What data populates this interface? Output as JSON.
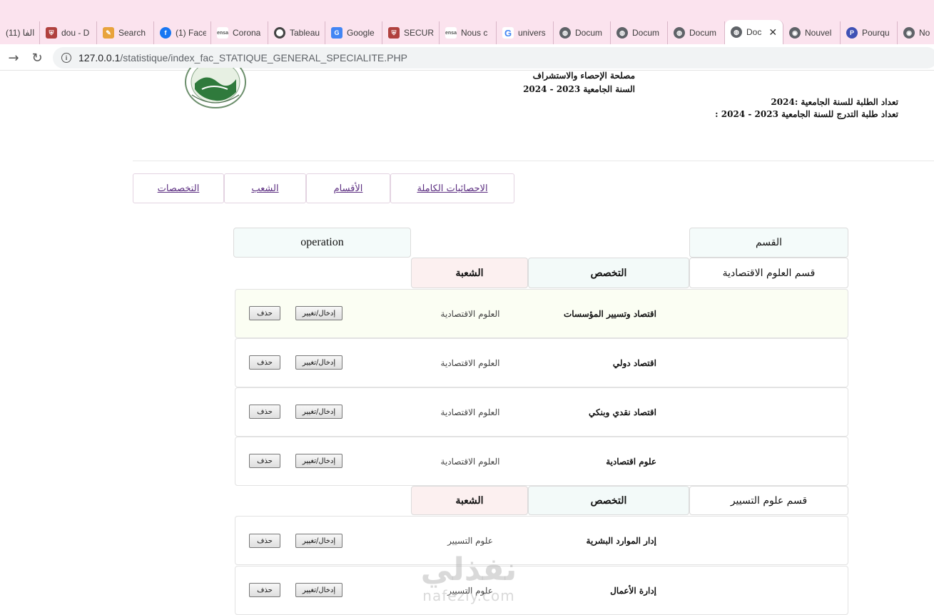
{
  "browser": {
    "tabs": [
      {
        "label": "(11) الفا",
        "icon": "generic-page-icon",
        "color": "#888888"
      },
      {
        "label": "dou - D",
        "icon": "shield-icon",
        "color": "#b0413e"
      },
      {
        "label": "Search",
        "icon": "search-app-icon",
        "color": "#e8a33c"
      },
      {
        "label": "(1) Face",
        "icon": "facebook-icon",
        "color": "#1877f2"
      },
      {
        "label": "Corona",
        "icon": "ensa-icon",
        "color": "#555555"
      },
      {
        "label": "Tableau",
        "icon": "circle-icon",
        "color": "#444444"
      },
      {
        "label": "Google",
        "icon": "google-translate-icon",
        "color": "#4285f4"
      },
      {
        "label": "SECURI",
        "icon": "shield-icon",
        "color": "#b0413e"
      },
      {
        "label": "Nous c",
        "icon": "ensa-icon",
        "color": "#555555"
      },
      {
        "label": "univers",
        "icon": "google-icon",
        "color": "#4285f4"
      },
      {
        "label": "Docum",
        "icon": "globe-icon",
        "color": "#5f6368"
      },
      {
        "label": "Docum",
        "icon": "globe-icon",
        "color": "#5f6368"
      },
      {
        "label": "Docum",
        "icon": "globe-icon",
        "color": "#5f6368"
      },
      {
        "label": "Doc",
        "icon": "globe-icon",
        "color": "#5f6368",
        "active": true
      },
      {
        "label": "Nouvel",
        "icon": "chrome-icon",
        "color": "#5f6368"
      },
      {
        "label": "Pourqu",
        "icon": "p-icon",
        "color": "#3f51b5"
      },
      {
        "label": "Nou",
        "icon": "chrome-icon",
        "color": "#5f6368"
      }
    ],
    "url_host": "127.0.0.1",
    "url_path": "/statistique/index_fac_STATIQUE_GENERAL_SPECIALITE.PHP"
  },
  "header": {
    "service": "مصلحة الإحصاء والاستشراف",
    "year": "السنة الجامعية 2023 - 2024",
    "students_count": "تعداد الطلبة للسنة الجامعية :2024",
    "grad_students_count": "تعداد طلبة التدرج للسنة الجامعية 2023 - 2024 :"
  },
  "nav": {
    "full_stats": "الاحصائيات الكاملة",
    "departments": "الأقسام",
    "branches": "الشعب",
    "specialties": "التخصصات"
  },
  "table": {
    "dept_header": "القسم",
    "operation_header": "operation",
    "spec_header": "التخصص",
    "branch_header": "الشعبة",
    "edit_label": "إدخال/تغيير",
    "delete_label": "حذف",
    "groups": [
      {
        "department": "قسم العلوم الاقتصادية",
        "rows": [
          {
            "specialty": "اقتصاد وتسيير المؤسسات",
            "branch": "العلوم الاقتصادية"
          },
          {
            "specialty": "اقتصاد دولي",
            "branch": "العلوم الاقتصادية"
          },
          {
            "specialty": "اقتصاد نقدي وبنكي",
            "branch": "العلوم الاقتصادية"
          },
          {
            "specialty": "علوم اقتصادية",
            "branch": "العلوم الاقتصادية"
          }
        ]
      },
      {
        "department": "قسم علوم التسيير",
        "rows": [
          {
            "specialty": "إدار الموارد البشرية",
            "branch": "علوم التسيير"
          },
          {
            "specialty": "إدارة الأعمال",
            "branch": "علوم التسيير"
          }
        ]
      }
    ]
  },
  "watermark": {
    "arabic": "نفذلي",
    "latin": "nafezly.com"
  }
}
